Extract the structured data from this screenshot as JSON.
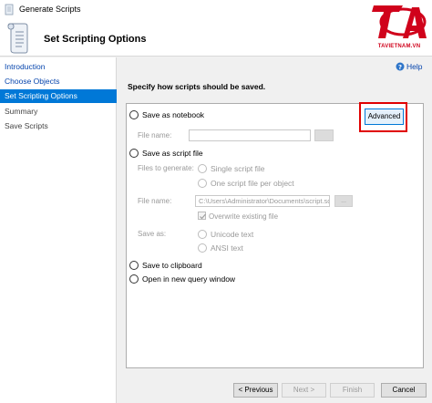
{
  "window": {
    "title": "Generate Scripts"
  },
  "header": {
    "title": "Set Scripting Options"
  },
  "logo": {
    "text": "TAVIETNAM.VN"
  },
  "sidebar": {
    "items": [
      {
        "label": "Introduction"
      },
      {
        "label": "Choose Objects"
      },
      {
        "label": "Set Scripting Options"
      },
      {
        "label": "Summary"
      },
      {
        "label": "Save Scripts"
      }
    ]
  },
  "help": {
    "label": "Help"
  },
  "main": {
    "instruction": "Specify how scripts should be saved.",
    "options": {
      "notebook": "Save as notebook",
      "script_file": "Save as script file",
      "clipboard": "Save to clipboard",
      "query_window": "Open in new query window"
    },
    "advanced_label": "Advanced",
    "notebook_file_name_label": "File name:",
    "notebook_file_name_value": "",
    "files_to_generate_label": "Files to generate:",
    "single_file": "Single script file",
    "one_per_object": "One script file per object",
    "script_file_name_label": "File name:",
    "script_file_name_value": "C:\\Users\\Administrator\\Documents\\script.sql",
    "browse_label": "...",
    "overwrite_label": "Overwrite existing file",
    "save_as_label": "Save as:",
    "unicode": "Unicode text",
    "ansi": "ANSI text"
  },
  "buttons": {
    "previous": "< Previous",
    "next": "Next >",
    "finish": "Finish",
    "cancel": "Cancel"
  },
  "colors": {
    "accent": "#0078d7",
    "highlight": "#e00000",
    "link": "#0645ad"
  }
}
